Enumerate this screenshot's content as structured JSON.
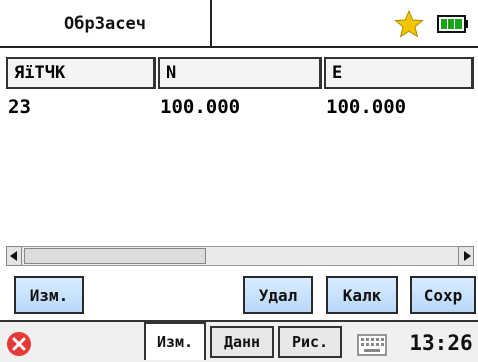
{
  "app": {
    "title": "ОбрЗасеч"
  },
  "table": {
    "columns": [
      "ЯїТЧК",
      "N",
      "E"
    ],
    "rows": [
      [
        "23",
        "100.000",
        "100.000"
      ]
    ]
  },
  "actions": {
    "edit": "Изм.",
    "delete": "Удал",
    "calc": "Калк",
    "save": "Сохр"
  },
  "tabs": {
    "edit": "Изм.",
    "data": "Данн",
    "draw": "Рис."
  },
  "status": {
    "time": "13:26"
  },
  "colors": {
    "star": "#f2c500",
    "battery": "#1aa31a",
    "close": "#e53935",
    "button": "#c6e2ff"
  }
}
